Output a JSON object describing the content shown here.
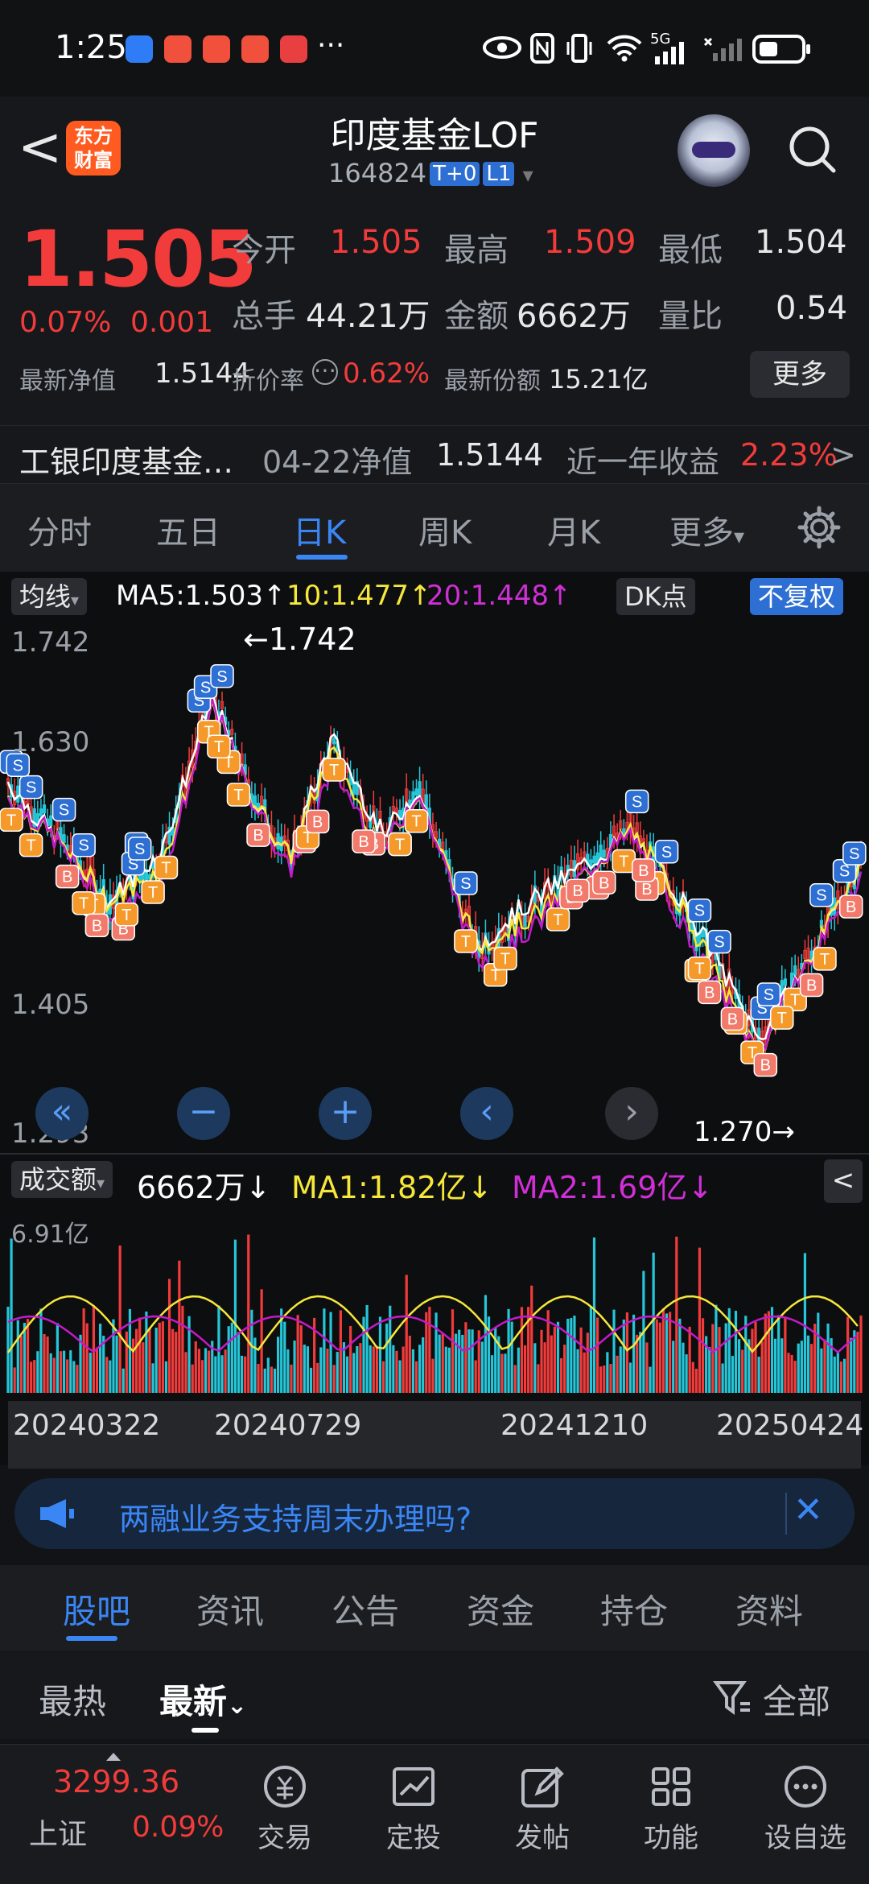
{
  "status": {
    "time": "1:25",
    "more": "···",
    "net": "5G"
  },
  "header": {
    "back": "<",
    "logo_line1": "东方",
    "logo_line2": "财富",
    "title": "印度基金LOF",
    "code": "164824",
    "tag1": "T+0",
    "tag2": "L1",
    "caret": "▾"
  },
  "quote": {
    "price": "1.505",
    "change_pct": "0.07%",
    "change": "0.001",
    "open_label": "今开",
    "open": "1.505",
    "high_label": "最高",
    "high": "1.509",
    "low_label": "最低",
    "low": "1.504",
    "vol_label": "总手",
    "vol": "44.21万",
    "amt_label": "金额",
    "amt": "6662万",
    "ratio_label": "量比",
    "ratio": "0.54",
    "nav_label": "最新净值",
    "nav": "1.5144",
    "disc_label": "折价率",
    "disc_info": "⋯",
    "disc": "0.62%",
    "shares_label": "最新份额",
    "shares": "15.21亿",
    "more": "更多"
  },
  "fund": {
    "name": "工银印度基金…",
    "date_label": "04-22净值",
    "nav": "1.5144",
    "ret_label": "近一年收益",
    "ret": "2.23%",
    "arrow": ">"
  },
  "tabs": [
    "分时",
    "五日",
    "日K",
    "周K",
    "月K",
    "更多"
  ],
  "tabs_more_caret": "▾",
  "ma_bar": {
    "ma_label": "均线",
    "caret": "▾",
    "ma5": "MA5:1.503↑",
    "ma10": "10:1.477↑",
    "ma20": "20:1.448↑",
    "dk": "DK点",
    "fq": "不复权"
  },
  "chart_labels": {
    "y_top": "1.742",
    "y_2": "1.630",
    "y_3": "1.405",
    "y_bottom": "1.293",
    "max_marker": "←1.742",
    "min_marker": "1.270→"
  },
  "zoom": [
    "«",
    "−",
    "+",
    "‹",
    "›"
  ],
  "vol_bar": {
    "label": "成交额",
    "caret": "▾",
    "value": "6662万↓",
    "ma1": "MA1:1.82亿↓",
    "ma2": "MA2:1.69亿↓",
    "collapse": "<",
    "ymax": "6.91亿"
  },
  "dates": [
    "20240322",
    "20240729",
    "20241210",
    "20250424"
  ],
  "banner": {
    "text": "两融业务支持周末办理吗?",
    "close": "✕"
  },
  "bottom_tabs": [
    "股吧",
    "资讯",
    "公告",
    "资金",
    "持仓",
    "资料"
  ],
  "sub_tabs": {
    "hot": "最热",
    "new": "最新",
    "new_caret": "⌄",
    "filter": "全部"
  },
  "nav": {
    "index_value": "3299.36",
    "index_name": "上证",
    "index_change": "0.09%",
    "items": [
      "交易",
      "定投",
      "发帖",
      "功能",
      "设自选"
    ]
  },
  "colors": {
    "up": "#f23b3b",
    "down": "#25c6d8",
    "accent": "#3b86f5",
    "ma5": "#ffffff",
    "ma10": "#f6e73a",
    "ma20": "#c21bc9"
  }
}
